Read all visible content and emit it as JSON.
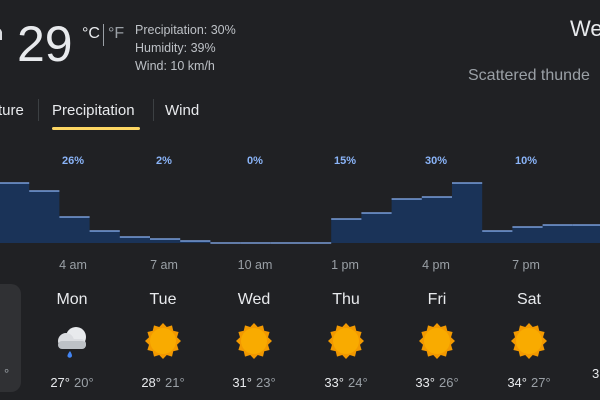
{
  "current": {
    "temperature": "29",
    "unit_c": "°C",
    "unit_f": "°F",
    "precipitation": "Precipitation: 30%",
    "humidity": "Humidity: 39%",
    "wind": "Wind: 10 km/h",
    "day_title": "We",
    "condition": "Scattered thunde"
  },
  "tabs": [
    {
      "label": "ture"
    },
    {
      "label": "Precipitation",
      "selected": true
    },
    {
      "label": "Wind"
    }
  ],
  "chart_data": {
    "type": "area",
    "series": [
      {
        "values": [
          30,
          26,
          13,
          6,
          3,
          2,
          1,
          0,
          0,
          0,
          0,
          12,
          15,
          22,
          23,
          30,
          6,
          8,
          9,
          9,
          10,
          11,
          14,
          15
        ]
      }
    ],
    "value_labels": [
      "26%",
      "2%",
      "0%",
      "15%",
      "30%",
      "10%"
    ],
    "x_ticks": [
      "4 am",
      "7 am",
      "10 am",
      "1 pm",
      "4 pm",
      "7 pm"
    ]
  },
  "forecast": [
    {
      "day": "Mon",
      "icon": "cloud-rain-icon",
      "high": "27°",
      "low": "20°"
    },
    {
      "day": "Tue",
      "icon": "sun-icon",
      "high": "28°",
      "low": "21°"
    },
    {
      "day": "Wed",
      "icon": "sun-icon",
      "high": "31°",
      "low": "23°"
    },
    {
      "day": "Thu",
      "icon": "sun-icon",
      "high": "33°",
      "low": "24°"
    },
    {
      "day": "Fri",
      "icon": "sun-icon",
      "high": "33°",
      "low": "26°"
    },
    {
      "day": "Sat",
      "icon": "sun-icon",
      "high": "34°",
      "low": "27°"
    }
  ],
  "partials": {
    "card_low": "°",
    "next_high": "3"
  },
  "colors": {
    "background": "#202124",
    "accent_tab": "#fdd663",
    "precip_fill": "#1a3358",
    "precip_line": "#8ab4f8",
    "sun": "#f9ab00"
  }
}
